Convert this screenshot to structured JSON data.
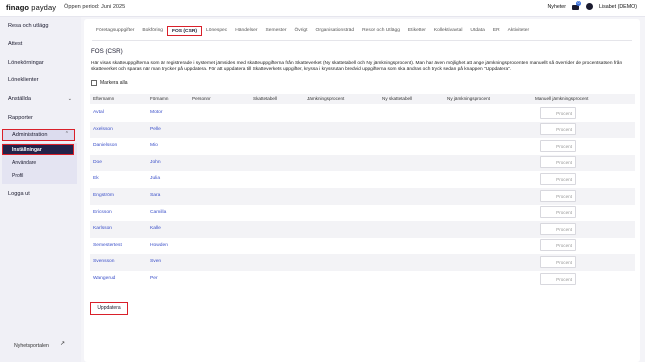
{
  "header": {
    "logo_main": "finago",
    "logo_sub": " payday",
    "period": "Öppen period: Juni 2025",
    "news": "Nyheter",
    "mail_badge": "0",
    "user": "Lisabet (DEMO)"
  },
  "sidebar": {
    "items": [
      {
        "label": "Resa och utlägg",
        "chevron": ""
      },
      {
        "label": "Attest",
        "chevron": ""
      },
      {
        "label": "Lönekörningar",
        "chevron": ""
      },
      {
        "label": "Löneklienter",
        "chevron": ""
      },
      {
        "label": "Anställda",
        "chevron": "⌄"
      },
      {
        "label": "Rapporter",
        "chevron": ""
      }
    ],
    "admin": {
      "label": "Administration",
      "chevron": "⌃"
    },
    "sub_items": [
      "Inställningar",
      "Användare",
      "Profil"
    ],
    "logout": "Logga ut",
    "news_portal": "Nyhetsportalen"
  },
  "tabs": [
    "Företagsuppgifter",
    "Bokföring",
    "FOS (CSR)",
    "Lönespec",
    "Händelser",
    "Semester",
    "Övrigt",
    "Organisationsträd",
    "Resor och Utlägg",
    "Etiketter",
    "Kollektivavtal",
    "Utdata",
    "ER",
    "Aktiviteter"
  ],
  "active_tab": "FOS (CSR)",
  "section": {
    "title": "FOS (CSR)",
    "description": "Här visas skatteuppgifterna som är registrerade i systemet jämsides med skatteuppgifterna från Skatteverket (Ny skattetabell och Ny jämkningsprocent). Man har även möjlighet att ange jämkningsprocenten manuellt så överrider de procentsatsen från skatteverket och sparas när man trycker på uppdatera. För att uppdatera till Skatteverkets uppgifter, kryssa i kryssrutan bredvid uppgifterna som ska ändras och tryck sedan på knappen \"Uppdatera\".",
    "mark_all": "Markera alla"
  },
  "table": {
    "columns": [
      "Efternamn",
      "Förnamn",
      "Personnr",
      "Skattetabell",
      "Jämkningsprocent",
      "Ny skattetabell",
      "Ny jämkningsprocent",
      "Manuell jämkningsprocent"
    ],
    "rows": [
      {
        "last": "Avtal",
        "first": "Motor"
      },
      {
        "last": "Axelsson",
        "first": "Pelle"
      },
      {
        "last": "Danielsson",
        "first": "Mio"
      },
      {
        "last": "Doe",
        "first": "John"
      },
      {
        "last": "Ek",
        "first": "Julia"
      },
      {
        "last": "Engström",
        "first": "Sara"
      },
      {
        "last": "Ericsson",
        "first": "Camilla"
      },
      {
        "last": "Karlsson",
        "first": "Kalle"
      },
      {
        "last": "Semestertest",
        "first": "Howden"
      },
      {
        "last": "Svensson",
        "first": "Sven"
      },
      {
        "last": "Wangerud",
        "first": "Per"
      }
    ],
    "input_placeholder": "Procent"
  },
  "buttons": {
    "update": "Uppdatera"
  },
  "colors": {
    "accent": "#3a4fc9",
    "highlight": "#d9202a",
    "nav_dark": "#23234a"
  }
}
